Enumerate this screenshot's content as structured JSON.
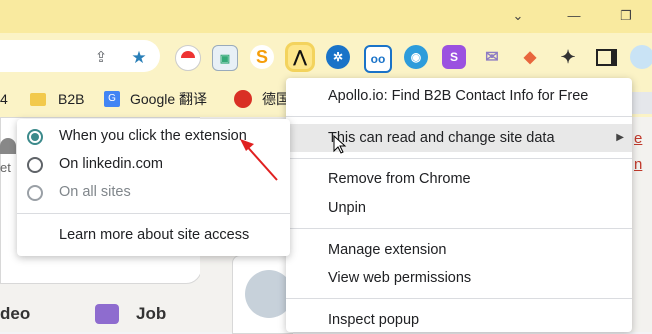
{
  "colors": {
    "accent": "#3c8a8b",
    "titlebar": "#f9ea9f",
    "toolbar": "#fbf3c6",
    "arrow": "#e02020"
  },
  "bookmarks": [
    {
      "label": "4",
      "icon": "none"
    },
    {
      "label": "B2B",
      "icon": "folder-icon"
    },
    {
      "label": "Google 翻译",
      "icon": "google-translate-icon"
    },
    {
      "label": "德国",
      "icon": "china-emblem-icon"
    }
  ],
  "context_menu": {
    "title": "Apollo.io: Find B2B Contact Info for Free",
    "site_data": "This can read and change site data",
    "remove": "Remove from Chrome",
    "unpin": "Unpin",
    "manage": "Manage extension",
    "permissions": "View web permissions",
    "inspect": "Inspect popup"
  },
  "site_access": {
    "options": [
      {
        "label": "When you click the extension",
        "selected": true,
        "disabled": false
      },
      {
        "label": "On linkedin.com",
        "selected": false,
        "disabled": false
      },
      {
        "label": "On all sites",
        "selected": false,
        "disabled": true
      }
    ],
    "learn_more": "Learn more about site access"
  },
  "page": {
    "left_text_1": "et",
    "bottom_left": "deo",
    "job_label": "Job",
    "right_edge_1": "e",
    "right_edge_2": "n"
  }
}
